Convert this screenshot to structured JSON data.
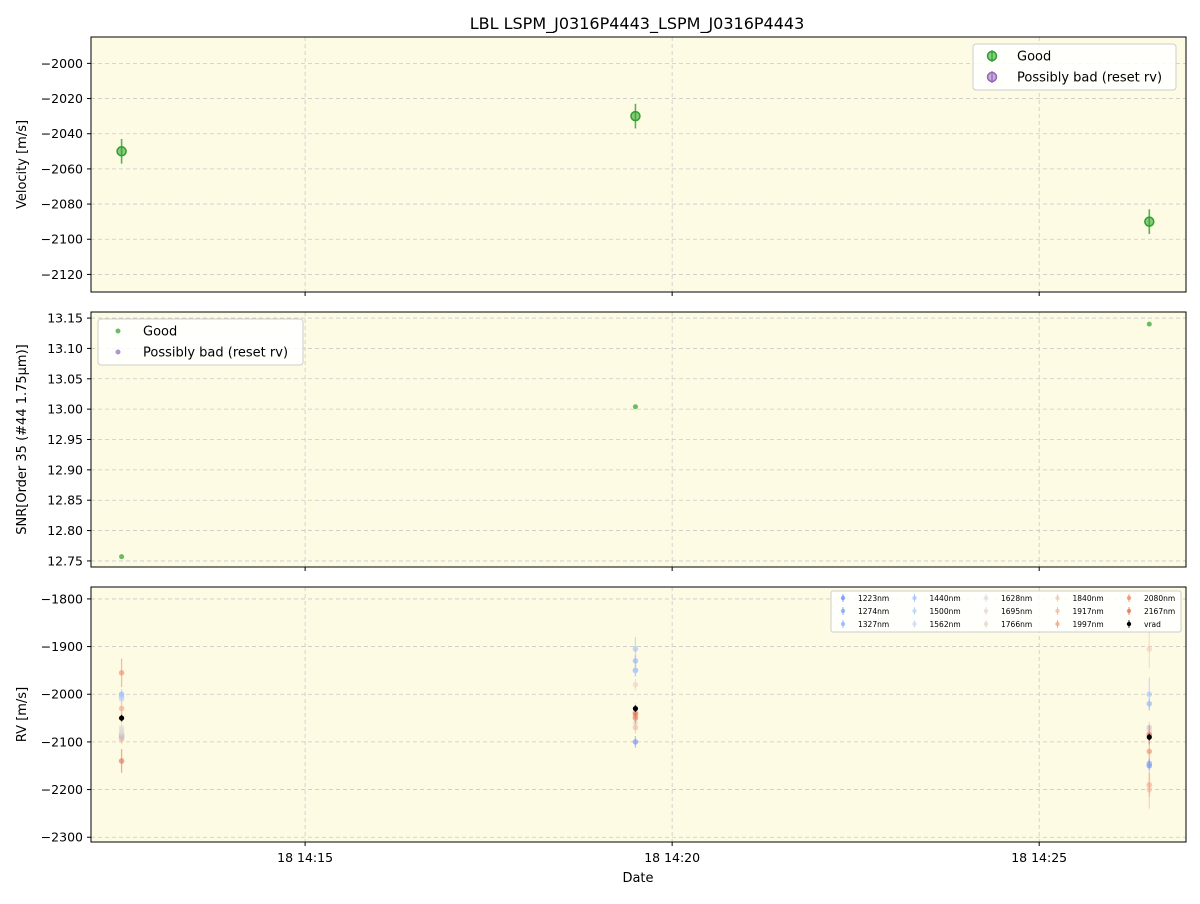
{
  "chart_data": [
    {
      "type": "scatter",
      "title": "LBL LSPM_J0316P4443_LSPM_J0316P4443",
      "xlabel": "",
      "ylabel": "Velocity [m/s]",
      "ylim": [
        -2130,
        -1985
      ],
      "yticks": [
        -2000,
        -2020,
        -2040,
        -2060,
        -2080,
        -2100,
        -2120
      ],
      "grid": true,
      "legend_position": "upper-right",
      "series": [
        {
          "name": "Good",
          "color": "#2ca02c",
          "points": [
            {
              "x": "14:12:30",
              "y": -2050,
              "err": 7
            },
            {
              "x": "14:19:30",
              "y": -2030,
              "err": 7
            },
            {
              "x": "14:26:30",
              "y": -2090,
              "err": 7
            }
          ]
        },
        {
          "name": "Possibly bad (reset rv)",
          "color": "#9467bd",
          "points": []
        }
      ]
    },
    {
      "type": "scatter",
      "ylabel": "SNR[Order 35 (#44 1.75μm)]",
      "ylim": [
        12.74,
        13.16
      ],
      "yticks": [
        13.15,
        13.1,
        13.05,
        13.0,
        12.95,
        12.9,
        12.85,
        12.8,
        12.75
      ],
      "grid": true,
      "legend_position": "upper-left",
      "series": [
        {
          "name": "Good",
          "color": "#2ca02c",
          "points": [
            {
              "x": "14:12:30",
              "y": 12.757
            },
            {
              "x": "14:19:30",
              "y": 13.004
            },
            {
              "x": "14:26:30",
              "y": 13.14
            }
          ]
        },
        {
          "name": "Possibly bad (reset rv)",
          "color": "#9467bd",
          "points": []
        }
      ]
    },
    {
      "type": "scatter",
      "xlabel": "Date",
      "ylabel": "RV [m/s]",
      "ylim": [
        -2310,
        -1775
      ],
      "yticks": [
        -1800,
        -1900,
        -2000,
        -2100,
        -2200,
        -2300
      ],
      "xticks": [
        "18 14:15",
        "18 14:20",
        "18 14:25"
      ],
      "grid": true,
      "legend_position": "upper-right",
      "series": [
        {
          "name": "1223nm",
          "color": "#6c8ff8",
          "points": [
            {
              "x": "14:12:30",
              "y": -2085,
              "err": 10
            },
            {
              "x": "14:19:30",
              "y": -2100,
              "err": 12
            },
            {
              "x": "14:26:30",
              "y": -2150,
              "err": 10
            }
          ]
        },
        {
          "name": "1274nm",
          "color": "#7b9ff9",
          "points": [
            {
              "x": "14:12:30",
              "y": -2090,
              "err": 10
            },
            {
              "x": "14:19:30",
              "y": -1950,
              "err": 12
            },
            {
              "x": "14:26:30",
              "y": -2145,
              "err": 10
            }
          ]
        },
        {
          "name": "1327nm",
          "color": "#8db0fe",
          "points": [
            {
              "x": "14:12:30",
              "y": -2000,
              "err": 10
            },
            {
              "x": "14:19:30",
              "y": -1930,
              "err": 12
            },
            {
              "x": "14:26:30",
              "y": -2020,
              "err": 12
            }
          ]
        },
        {
          "name": "1440nm",
          "color": "#a3c2fe",
          "points": [
            {
              "x": "14:12:30",
              "y": -2005,
              "err": 10
            },
            {
              "x": "14:19:30",
              "y": -1905,
              "err": 25
            },
            {
              "x": "14:26:30",
              "y": -2000,
              "err": 35
            }
          ]
        },
        {
          "name": "1500nm",
          "color": "#b9d0f9",
          "points": [
            {
              "x": "14:12:30",
              "y": -2010,
              "err": 10
            },
            {
              "x": "14:19:30",
              "y": -1950,
              "err": 12
            },
            {
              "x": "14:26:30",
              "y": -2070,
              "err": 12
            }
          ]
        },
        {
          "name": "1562nm",
          "color": "#cdd9ec",
          "points": [
            {
              "x": "14:12:30",
              "y": -2080,
              "err": 10
            },
            {
              "x": "14:19:30",
              "y": -2030,
              "err": 12
            },
            {
              "x": "14:26:30",
              "y": -2080,
              "err": 12
            }
          ]
        },
        {
          "name": "1628nm",
          "color": "#dcdddd",
          "points": [
            {
              "x": "14:12:30",
              "y": -2070,
              "err": 10
            },
            {
              "x": "14:19:30",
              "y": -2060,
              "err": 12
            },
            {
              "x": "14:26:30",
              "y": -2075,
              "err": 12
            }
          ]
        },
        {
          "name": "1695nm",
          "color": "#e7d7cd",
          "points": [
            {
              "x": "14:12:30",
              "y": -2075,
              "err": 10
            },
            {
              "x": "14:19:30",
              "y": -2040,
              "err": 12
            },
            {
              "x": "14:26:30",
              "y": -2085,
              "err": 12
            }
          ]
        },
        {
          "name": "1766nm",
          "color": "#ecd3c5",
          "points": [
            {
              "x": "14:12:30",
              "y": -2085,
              "err": 10
            },
            {
              "x": "14:19:30",
              "y": -1980,
              "err": 12
            },
            {
              "x": "14:26:30",
              "y": -2070,
              "err": 12
            }
          ]
        },
        {
          "name": "1840nm",
          "color": "#f2c9b4",
          "points": [
            {
              "x": "14:12:30",
              "y": -2050,
              "err": 12
            },
            {
              "x": "14:19:30",
              "y": -2050,
              "err": 12
            },
            {
              "x": "14:26:30",
              "y": -1905,
              "err": 40
            }
          ]
        },
        {
          "name": "1917nm",
          "color": "#f5b89d",
          "points": [
            {
              "x": "14:12:30",
              "y": -2095,
              "err": 10
            },
            {
              "x": "14:19:30",
              "y": -2070,
              "err": 12
            },
            {
              "x": "14:26:30",
              "y": -2200,
              "err": 40
            }
          ]
        },
        {
          "name": "1997nm",
          "color": "#f6a283",
          "points": [
            {
              "x": "14:12:30",
              "y": -2030,
              "err": 12
            },
            {
              "x": "14:19:30",
              "y": -2045,
              "err": 12
            },
            {
              "x": "14:26:30",
              "y": -2190,
              "err": 25
            }
          ]
        },
        {
          "name": "2080nm",
          "color": "#f08a6c",
          "points": [
            {
              "x": "14:12:30",
              "y": -1955,
              "err": 30
            },
            {
              "x": "14:19:30",
              "y": -2050,
              "err": 12
            },
            {
              "x": "14:26:30",
              "y": -2120,
              "err": 20
            }
          ]
        },
        {
          "name": "2167nm",
          "color": "#e36f55",
          "points": [
            {
              "x": "14:12:30",
              "y": -2140,
              "err": 25
            },
            {
              "x": "14:19:30",
              "y": -2040,
              "err": 12
            },
            {
              "x": "14:26:30",
              "y": -2085,
              "err": 20
            }
          ]
        },
        {
          "name": "vrad",
          "color": "#000000",
          "points": [
            {
              "x": "14:12:30",
              "y": -2050,
              "err": 7
            },
            {
              "x": "14:19:30",
              "y": -2030,
              "err": 7
            },
            {
              "x": "14:26:30",
              "y": -2090,
              "err": 7
            }
          ]
        }
      ]
    }
  ]
}
